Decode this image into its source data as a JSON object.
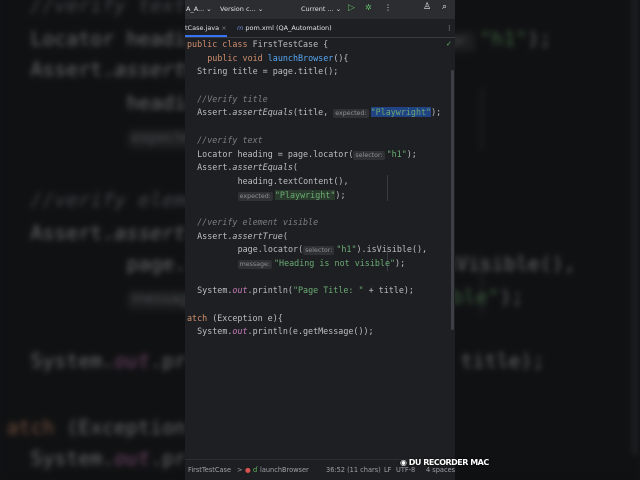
{
  "toolbar": {
    "project": "A_A...",
    "vcs": "Version c...",
    "run_config": "Current ...",
    "run_icon": "play-icon",
    "debug_icon": "bug-icon"
  },
  "tabs": [
    {
      "label": "tCase.java",
      "active": true
    },
    {
      "label": "pom.xml (QA_Automation)",
      "active": false
    }
  ],
  "code_lines": [
    {
      "indent": 0,
      "tokens": [
        {
          "t": "public class ",
          "c": "kw"
        },
        {
          "t": "FirstTestCase {",
          "c": ""
        }
      ]
    },
    {
      "indent": 4,
      "tokens": [
        {
          "t": "public void ",
          "c": "kw"
        },
        {
          "t": "launchBrowser",
          "c": "fn"
        },
        {
          "t": "(){",
          "c": ""
        }
      ]
    },
    {
      "indent": 2,
      "tokens": [
        {
          "t": "String title = page.title();",
          "c": ""
        }
      ]
    },
    {
      "indent": 2,
      "tokens": []
    },
    {
      "indent": 2,
      "tokens": [
        {
          "t": "//Verify title",
          "c": "cm"
        }
      ]
    },
    {
      "indent": 2,
      "tokens": [
        {
          "t": "Assert.",
          "c": ""
        },
        {
          "t": "assertEquals",
          "c": "it"
        },
        {
          "t": "(title, ",
          "c": ""
        },
        {
          "t": "expected:",
          "c": "hint"
        },
        {
          "t": "\"Playwright\"",
          "c": "str hl"
        },
        {
          "t": ");",
          "c": ""
        }
      ]
    },
    {
      "indent": 2,
      "tokens": []
    },
    {
      "indent": 2,
      "tokens": [
        {
          "t": "//verify text",
          "c": "cm"
        }
      ]
    },
    {
      "indent": 2,
      "tokens": [
        {
          "t": "Locator heading = page.locator(",
          "c": ""
        },
        {
          "t": "selector:",
          "c": "hint"
        },
        {
          "t": "\"h1\"",
          "c": "str"
        },
        {
          "t": ");",
          "c": ""
        }
      ]
    },
    {
      "indent": 2,
      "tokens": [
        {
          "t": "Assert.",
          "c": ""
        },
        {
          "t": "assertEquals",
          "c": "it"
        },
        {
          "t": "(",
          "c": ""
        }
      ]
    },
    {
      "indent": 10,
      "tokens": [
        {
          "t": "heading.textContent(),",
          "c": ""
        }
      ]
    },
    {
      "indent": 10,
      "tokens": [
        {
          "t": "expected:",
          "c": "hint"
        },
        {
          "t": "\"Playwright\"",
          "c": "str hlg"
        },
        {
          "t": ");",
          "c": ""
        }
      ]
    },
    {
      "indent": 2,
      "tokens": []
    },
    {
      "indent": 2,
      "tokens": [
        {
          "t": "//verify element visible",
          "c": "cm"
        }
      ]
    },
    {
      "indent": 2,
      "tokens": [
        {
          "t": "Assert.",
          "c": ""
        },
        {
          "t": "assertTrue",
          "c": "it"
        },
        {
          "t": "(",
          "c": ""
        }
      ]
    },
    {
      "indent": 10,
      "tokens": [
        {
          "t": "page.locator(",
          "c": ""
        },
        {
          "t": "selector:",
          "c": "hint"
        },
        {
          "t": "\"h1\"",
          "c": "str"
        },
        {
          "t": ").isVisible(),",
          "c": ""
        }
      ]
    },
    {
      "indent": 10,
      "tokens": [
        {
          "t": "message:",
          "c": "hint"
        },
        {
          "t": "\"Heading is not visible\"",
          "c": "str"
        },
        {
          "t": ");",
          "c": ""
        }
      ]
    },
    {
      "indent": 2,
      "tokens": []
    },
    {
      "indent": 2,
      "tokens": [
        {
          "t": "System.",
          "c": ""
        },
        {
          "t": "out",
          "c": "st"
        },
        {
          "t": ".println(",
          "c": ""
        },
        {
          "t": "\"Page Title: \"",
          "c": "str"
        },
        {
          "t": " + title);",
          "c": ""
        }
      ]
    },
    {
      "indent": 2,
      "tokens": []
    },
    {
      "indent": 0,
      "tokens": [
        {
          "t": "atch ",
          "c": "kw"
        },
        {
          "t": "(Exception e){",
          "c": ""
        }
      ]
    },
    {
      "indent": 2,
      "tokens": [
        {
          "t": "System.",
          "c": ""
        },
        {
          "t": "out",
          "c": "st"
        },
        {
          "t": ".println(e.getMessage());",
          "c": ""
        }
      ]
    }
  ],
  "status": {
    "file": "FirstTestCase",
    "separator": ">",
    "method": "launchBrowser",
    "position": "36:52 (11 chars)",
    "line_ending": "LF",
    "encoding": "UTF-8",
    "indent": "4 spaces"
  },
  "watermark": "DU RECORDER MAC",
  "colors": {
    "background": "#1e1f22",
    "keyword": "#cf8e6d",
    "string": "#6aab73",
    "comment": "#7a7e85",
    "selection": "#214283"
  }
}
